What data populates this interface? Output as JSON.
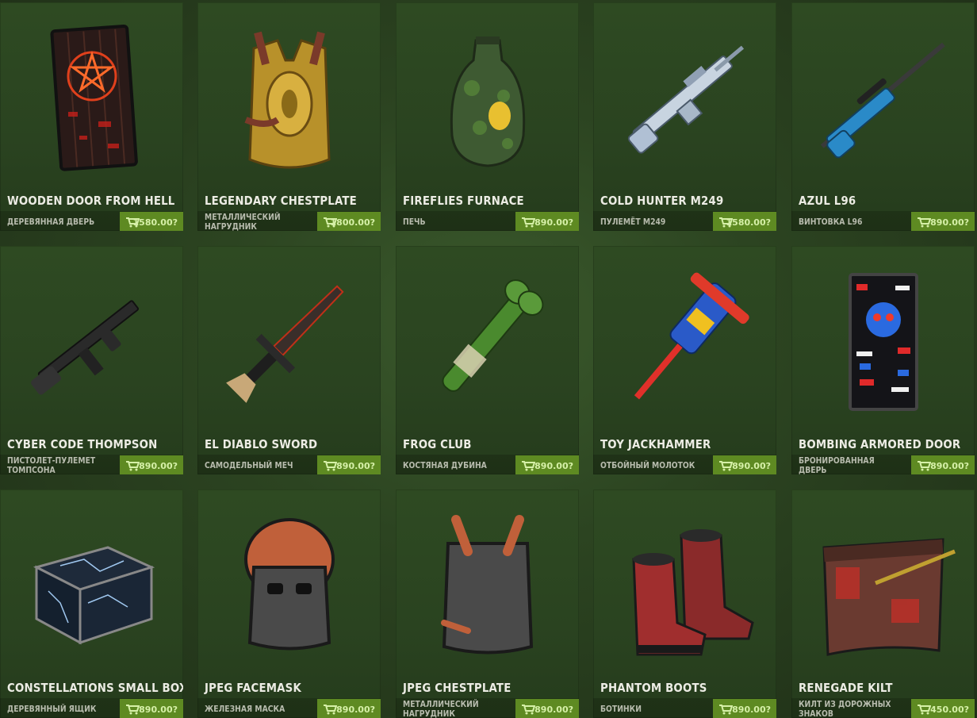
{
  "colors": {
    "card_bg": "#2e4a22",
    "price_bg": "#5e8a22",
    "price_text": "#d6f0a8",
    "title_text": "#ecece4",
    "subtitle_text": "#b8bcae"
  },
  "items": [
    {
      "name": "WOODEN DOOR FROM HELL",
      "subtitle": "ДЕРЕВЯННАЯ ДВЕРЬ",
      "price": "1580.00?",
      "icon": "hell-door-icon"
    },
    {
      "name": "LEGENDARY CHESTPLATE",
      "subtitle": "МЕТАЛЛИЧЕСКИЙ НАГРУДНИК",
      "price": "1800.00?",
      "icon": "gold-chestplate-icon"
    },
    {
      "name": "FIREFLIES FURNACE",
      "subtitle": "ПЕЧЬ",
      "price": "890.00?",
      "icon": "furnace-icon"
    },
    {
      "name": "COLD HUNTER M249",
      "subtitle": "ПУЛЕМЁТ M249",
      "price": "1580.00?",
      "icon": "m249-icon"
    },
    {
      "name": "AZUL L96",
      "subtitle": "ВИНТОВКА L96",
      "price": "890.00?",
      "icon": "l96-rifle-icon"
    },
    {
      "name": "CYBER CODE THOMPSON",
      "subtitle": "ПИСТОЛЕТ-ПУЛЕМЕТ ТОМПСОНА",
      "price": "890.00?",
      "icon": "thompson-icon"
    },
    {
      "name": "EL DIABLO SWORD",
      "subtitle": "САМОДЕЛЬНЫЙ МЕЧ",
      "price": "890.00?",
      "icon": "sword-icon"
    },
    {
      "name": "FROG CLUB",
      "subtitle": "КОСТЯНАЯ ДУБИНА",
      "price": "890.00?",
      "icon": "bone-club-icon"
    },
    {
      "name": "TOY JACKHAMMER",
      "subtitle": "ОТБОЙНЫЙ МОЛОТОК",
      "price": "890.00?",
      "icon": "jackhammer-icon"
    },
    {
      "name": "BOMBING ARMORED DOOR",
      "subtitle": "БРОНИРОВАННАЯ ДВЕРЬ",
      "price": "890.00?",
      "icon": "armored-door-icon"
    },
    {
      "name": "CONSTELLATIONS SMALL BOX",
      "subtitle": "ДЕРЕВЯННЫЙ ЯЩИК",
      "price": "890.00?",
      "icon": "small-box-icon"
    },
    {
      "name": "JPEG FACEMASK",
      "subtitle": "ЖЕЛЕЗНАЯ МАСКА",
      "price": "890.00?",
      "icon": "facemask-icon"
    },
    {
      "name": "JPEG CHESTPLATE",
      "subtitle": "МЕТАЛЛИЧЕСКИЙ НАГРУДНИК",
      "price": "890.00?",
      "icon": "chestplate-icon"
    },
    {
      "name": "PHANTOM BOOTS",
      "subtitle": "БОТИНКИ",
      "price": "890.00?",
      "icon": "boots-icon"
    },
    {
      "name": "RENEGADE KILT",
      "subtitle": "КИЛТ ИЗ ДОРОЖНЫХ ЗНАКОВ",
      "price": "450.00?",
      "icon": "kilt-icon"
    }
  ]
}
